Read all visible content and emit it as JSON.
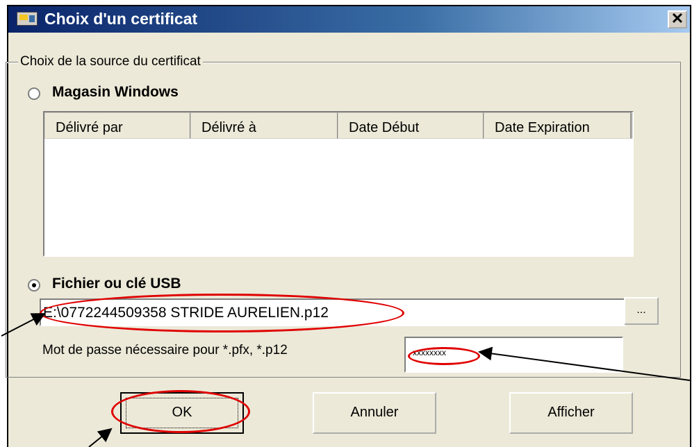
{
  "window": {
    "title": "Choix d'un certificat",
    "close_glyph": "✕"
  },
  "group": {
    "legend": "Choix de la source du certificat"
  },
  "store": {
    "label": "Magasin Windows",
    "selected": false,
    "columns": [
      "Délivré par",
      "Délivré à",
      "Date Début",
      "Date Expiration"
    ]
  },
  "file": {
    "label": "Fichier ou clé USB",
    "selected": true,
    "path": "E:\\0772244509358 STRIDE AURELIEN.p12",
    "browse_label": "..."
  },
  "password": {
    "label": "Mot de passe nécessaire pour *.pfx, *.p12",
    "masked_value": "xxxxxxxx"
  },
  "buttons": {
    "ok": "OK",
    "cancel": "Annuler",
    "show": "Afficher"
  },
  "annotations": {
    "highlight_color": "#e00000",
    "arrow_color": "#000000"
  }
}
